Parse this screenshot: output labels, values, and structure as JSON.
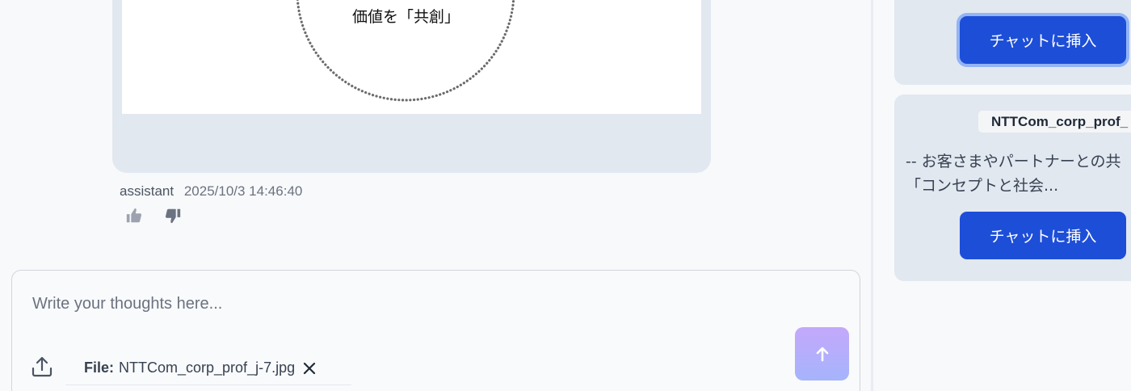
{
  "message": {
    "image_text": "価値を「共創」",
    "author": "assistant",
    "timestamp": "2025/10/3 14:46:40"
  },
  "icons": {
    "thumbs_up": "thumbs-up-icon",
    "thumbs_down": "thumbs-down-icon",
    "upload": "upload-icon",
    "close": "close-icon",
    "send": "arrow-up-icon"
  },
  "composer": {
    "placeholder": "Write your thoughts here...",
    "attachment_label": "File:",
    "attachment_name": "NTTCom_corp_prof_j-7.jpg"
  },
  "sidebar": {
    "cards": [
      {
        "button_label": "チャットに挿入"
      },
      {
        "file_name": "NTTCom_corp_prof_",
        "excerpt_line1": "-- お客さまやパートナーとの共",
        "excerpt_line2": "「コンセプトと社会...",
        "button_label": "チャットに挿入"
      }
    ]
  },
  "colors": {
    "primary_button": "#1d4ed8",
    "card_bg": "#e2e8f0",
    "send_gradient_top": "#c4a8fb",
    "send_gradient_bottom": "#a5b4fc"
  }
}
